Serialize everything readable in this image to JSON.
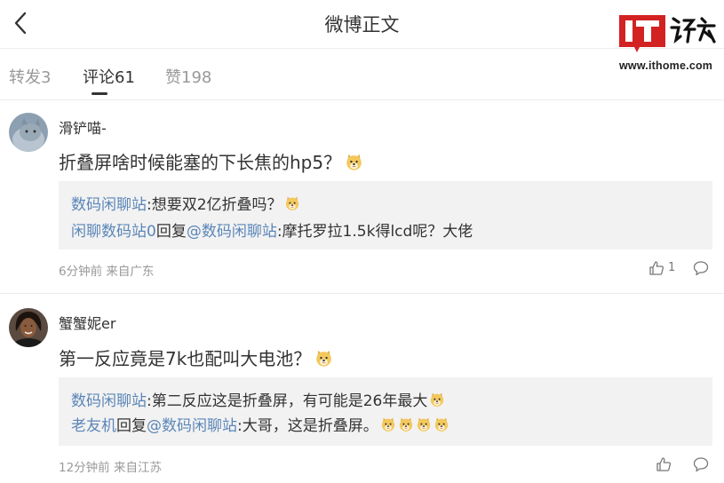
{
  "header": {
    "title": "微博正文"
  },
  "logo": {
    "mark": "IT之家",
    "url": "www.ithome.com"
  },
  "tabs": [
    {
      "label": "转发3",
      "active": false
    },
    {
      "label": "评论61",
      "active": true
    },
    {
      "label": "赞198",
      "active": false
    }
  ],
  "comments": [
    {
      "user": "滑铲喵-",
      "text": "折叠屏啥时候能塞的下长焦的hp5？",
      "replies": [
        {
          "author": "数码闲聊站",
          "sep": ":",
          "body": "想要双2亿折叠吗？",
          "emoji_count": 1
        },
        {
          "author": "闲聊数码站0",
          "reply_word": "回复",
          "target": "@数码闲聊站",
          "sep": ":",
          "body": "摩托罗拉1.5k得lcd呢？大佬",
          "emoji_count": 0
        }
      ],
      "meta": "6分钟前  来自广东",
      "likes": "1"
    },
    {
      "user": "蟹蟹妮er",
      "text": "第一反应竟是7k也配叫大电池？",
      "replies": [
        {
          "author": "数码闲聊站",
          "sep": ":",
          "body": "第二反应这是折叠屏，有可能是26年最大",
          "emoji_count": 1
        },
        {
          "author": "老友机",
          "reply_word": "回复",
          "target": "@数码闲聊站",
          "sep": ":",
          "body": "大哥，这是折叠屏。",
          "emoji_count": 4
        }
      ],
      "meta": "12分钟前  来自江苏",
      "likes": ""
    }
  ],
  "emoji_name": "doge-emoji",
  "colors": {
    "link": "#5b86b8",
    "logo_red": "#d22222",
    "reply_bg": "#f2f2f2"
  }
}
